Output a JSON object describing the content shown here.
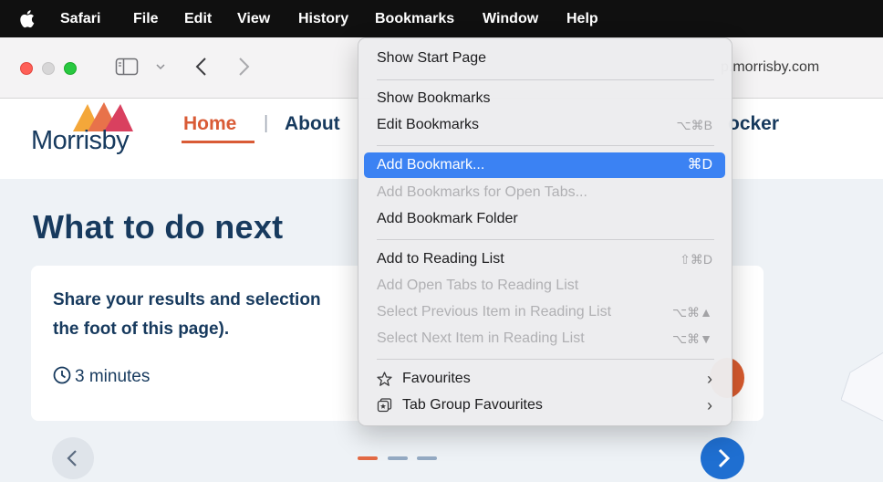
{
  "menubar": {
    "app": "Safari",
    "items": [
      "File",
      "Edit",
      "View",
      "History",
      "Bookmarks",
      "Window",
      "Help"
    ],
    "active": "Bookmarks"
  },
  "toolbar": {
    "address_partial": "p.morrisby.com"
  },
  "site": {
    "logo_text": "Morrisby",
    "nav": {
      "home": "Home",
      "separator": "|",
      "about": "About",
      "locker": "ocker"
    },
    "title": "What to do next",
    "card": {
      "line1": "Share your results and selection",
      "line2": "the foot of this page).",
      "time": "3 minutes"
    }
  },
  "bookmarks_menu": {
    "items": [
      {
        "label": "Show Start Page",
        "shortcut": "",
        "state": "normal"
      },
      {
        "label": "Show Bookmarks",
        "shortcut": "",
        "state": "normal"
      },
      {
        "label": "Edit Bookmarks",
        "shortcut": "⌥⌘B",
        "state": "normal"
      },
      {
        "label": "Add Bookmark...",
        "shortcut": "⌘D",
        "state": "highlighted"
      },
      {
        "label": "Add Bookmarks for Open Tabs...",
        "shortcut": "",
        "state": "disabled"
      },
      {
        "label": "Add Bookmark Folder",
        "shortcut": "",
        "state": "normal"
      },
      {
        "label": "Add to Reading List",
        "shortcut": "⇧⌘D",
        "state": "normal"
      },
      {
        "label": "Add Open Tabs to Reading List",
        "shortcut": "",
        "state": "disabled"
      },
      {
        "label": "Select Previous Item in Reading List",
        "shortcut": "⌥⌘▲",
        "state": "disabled"
      },
      {
        "label": "Select Next Item in Reading List",
        "shortcut": "⌥⌘▼",
        "state": "disabled"
      },
      {
        "label": "Favourites",
        "shortcut": "",
        "state": "submenu",
        "icon": "star-icon"
      },
      {
        "label": "Tab Group Favourites",
        "shortcut": "",
        "state": "submenu",
        "icon": "tab-group-icon"
      }
    ],
    "submenu_arrow": "›"
  },
  "colors": {
    "menu_highlight": "#3b82f3",
    "brand_navy": "#173a5e",
    "brand_orange": "#d95b36",
    "next_button": "#1f6fd1"
  }
}
